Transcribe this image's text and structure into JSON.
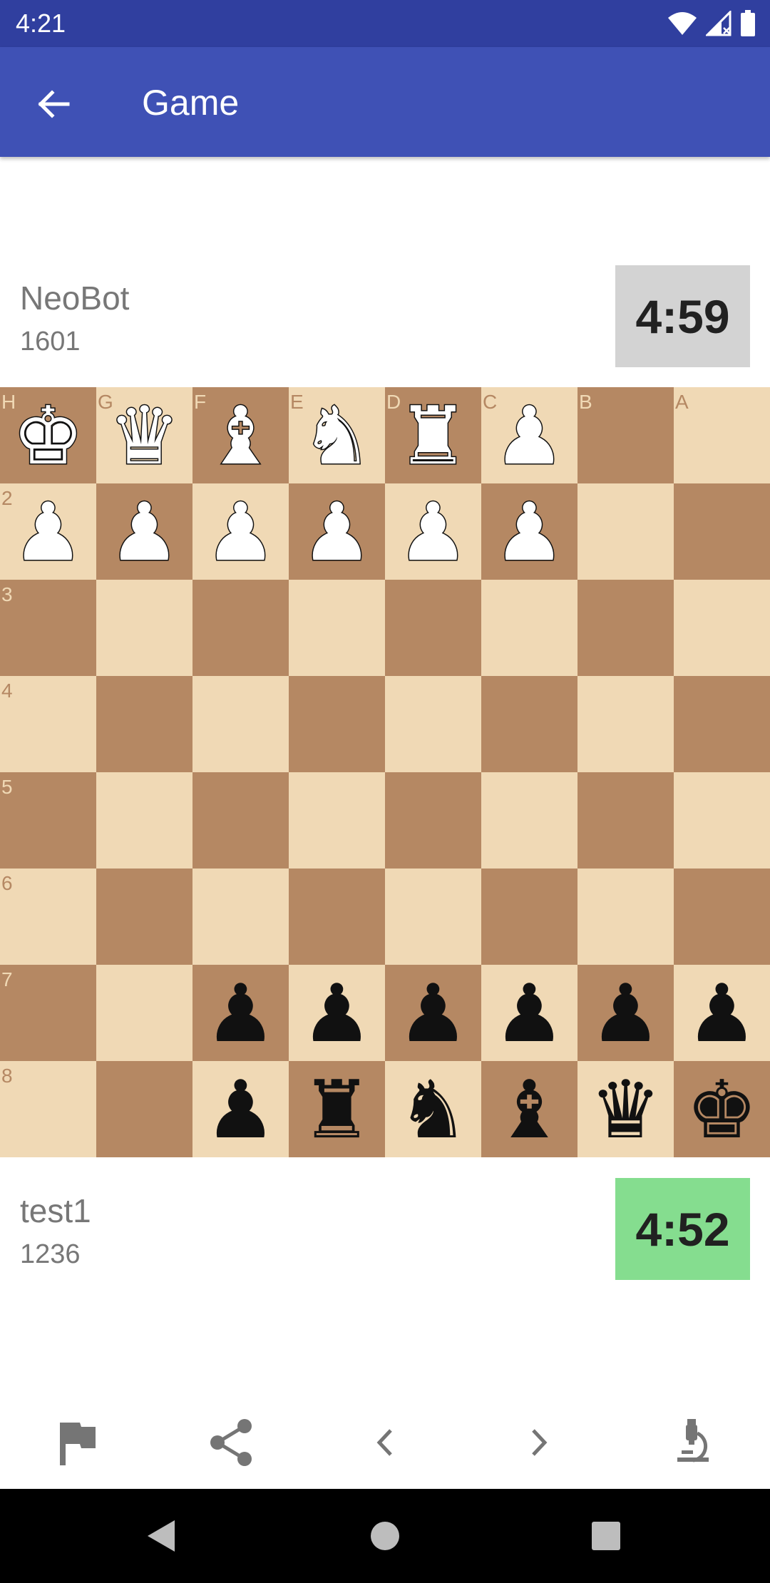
{
  "status_bar": {
    "time": "4:21",
    "icons": [
      "wifi-icon",
      "signal-icon",
      "battery-icon"
    ]
  },
  "app_bar": {
    "title": "Game",
    "back_icon": "arrow-back-icon",
    "color": "#3f51b5",
    "status_color": "#303f9f"
  },
  "opponent": {
    "name": "NeoBot",
    "rating": "1601",
    "clock": "4:59",
    "clock_color": "#d3d3d3"
  },
  "player": {
    "name": "test1",
    "rating": "1236",
    "clock": "4:52",
    "clock_color": "#85dd8f"
  },
  "board": {
    "light_color": "#f0d9b5",
    "dark_color": "#b58863",
    "file_labels": [
      "H",
      "G",
      "F",
      "E",
      "D",
      "C",
      "B",
      "A"
    ],
    "rank_labels": [
      "",
      "2",
      "3",
      "4",
      "5",
      "6",
      "7",
      "8"
    ],
    "rows": [
      [
        "wK",
        "wQ",
        "wB",
        "wN",
        "wR",
        "wP",
        "",
        ""
      ],
      [
        "wP",
        "wP",
        "wP",
        "wP",
        "wP",
        "wP",
        "",
        ""
      ],
      [
        "",
        "",
        "",
        "",
        "",
        "",
        "",
        ""
      ],
      [
        "",
        "",
        "",
        "",
        "",
        "",
        "",
        ""
      ],
      [
        "",
        "",
        "",
        "",
        "",
        "",
        "",
        ""
      ],
      [
        "",
        "",
        "",
        "",
        "",
        "",
        "",
        ""
      ],
      [
        "",
        "",
        "bP",
        "bP",
        "bP",
        "bP",
        "bP",
        "bP"
      ],
      [
        "",
        "",
        "bP",
        "bR",
        "bN",
        "bB",
        "bQ",
        "bK"
      ]
    ]
  },
  "toolbar": {
    "buttons": [
      "flag-icon",
      "share-icon",
      "chevron-left-icon",
      "chevron-right-icon",
      "microscope-icon"
    ]
  },
  "nav_bar": {
    "buttons": [
      "back-triangle-icon",
      "home-circle-icon",
      "recents-square-icon"
    ]
  }
}
